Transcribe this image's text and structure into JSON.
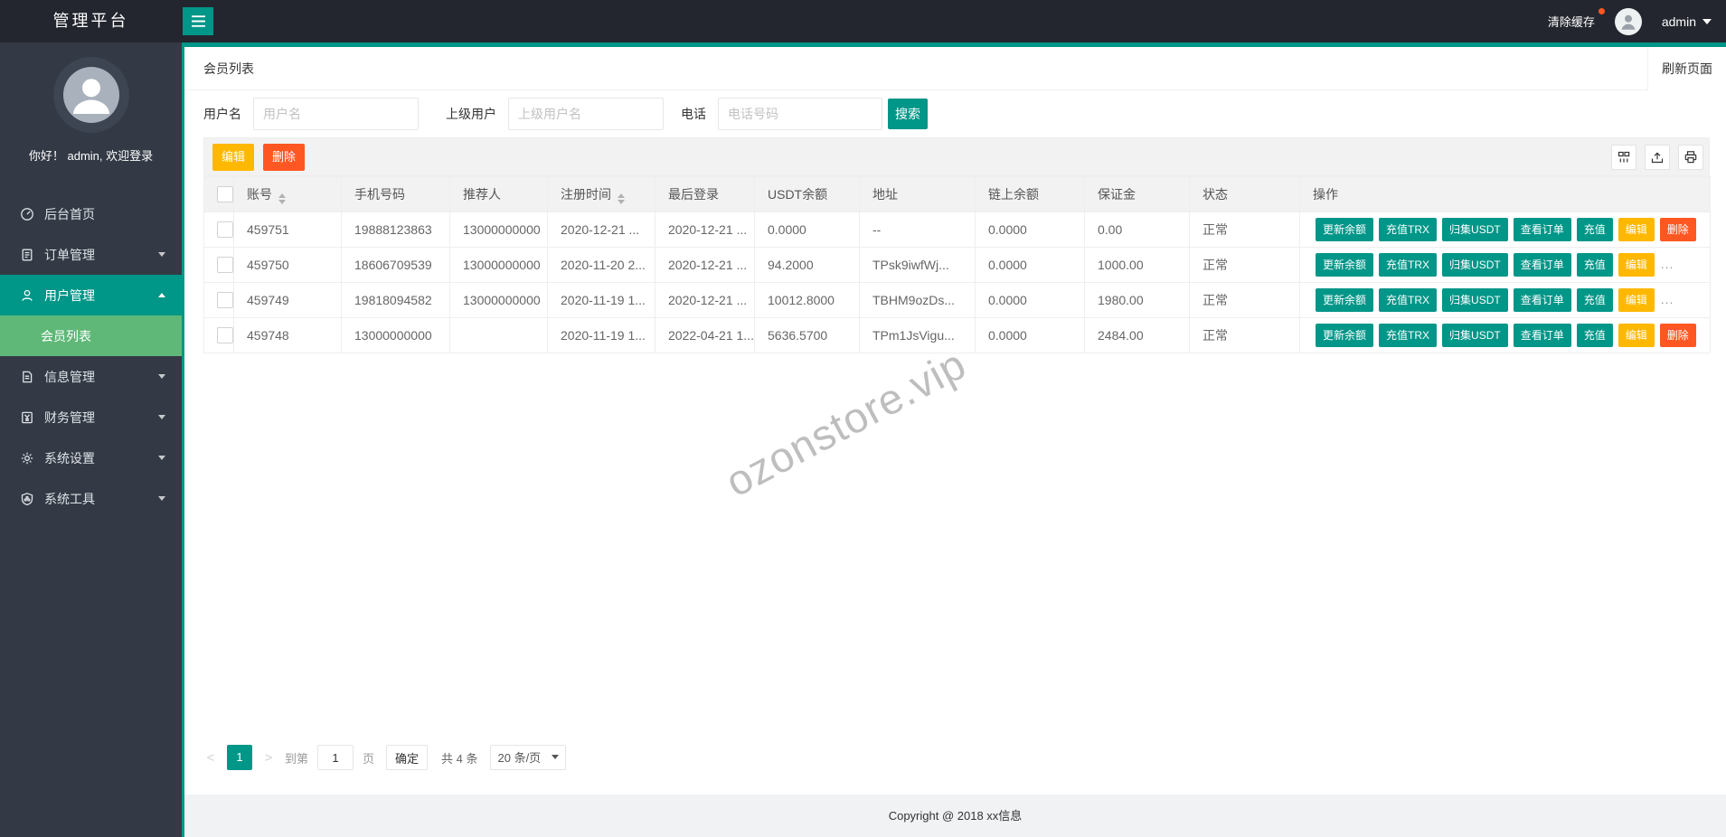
{
  "app": {
    "accent": "#009688",
    "submenu_green": "#5FB878",
    "warn": "#FFB800",
    "danger": "#FF5722"
  },
  "header": {
    "brand": "管理平台",
    "clear_cache": "清除缓存",
    "username": "admin"
  },
  "sidebar": {
    "greeting": "你好！ admin, 欢迎登录",
    "items": [
      {
        "label": "后台首页",
        "icon": "dashboard-icon"
      },
      {
        "label": "订单管理",
        "icon": "orders-icon"
      },
      {
        "label": "用户管理",
        "icon": "users-icon"
      },
      {
        "label": "会员列表",
        "icon": null
      },
      {
        "label": "信息管理",
        "icon": "info-icon"
      },
      {
        "label": "财务管理",
        "icon": "finance-icon"
      },
      {
        "label": "系统设置",
        "icon": "settings-icon"
      },
      {
        "label": "系统工具",
        "icon": "tools-icon"
      }
    ]
  },
  "page": {
    "title": "会员列表",
    "refresh": "刷新页面",
    "watermark": "ozonstore.vip",
    "footer": "Copyright @ 2018 xx信息"
  },
  "search": {
    "fields": [
      {
        "label": "用户名",
        "placeholder": "用户名"
      },
      {
        "label": "上级用户",
        "placeholder": "上级用户名"
      },
      {
        "label": "电话",
        "placeholder": "电话号码"
      }
    ],
    "submit": "搜索"
  },
  "toolbar": {
    "edit": "编辑",
    "delete": "删除",
    "view_icons": [
      "columns-icon",
      "export-icon",
      "print-icon"
    ]
  },
  "table": {
    "columns": [
      "账号",
      "手机号码",
      "推荐人",
      "注册时间",
      "最后登录",
      "USDT余额",
      "地址",
      "链上余额",
      "保证金",
      "状态",
      "操作"
    ],
    "actions": [
      "更新余额",
      "充值TRX",
      "归集USDT",
      "查看订单",
      "充值",
      "编辑",
      "删除"
    ],
    "more_label": "...",
    "rows": [
      {
        "account": "459751",
        "phone": "19888123863",
        "referrer": "13000000000",
        "reg_time": "2020-12-21 ...",
        "last_login": "2020-12-21 ...",
        "usdt": "0.0000",
        "address": "--",
        "chain": "0.0000",
        "deposit": "0.00",
        "status": "正常"
      },
      {
        "account": "459750",
        "phone": "18606709539",
        "referrer": "13000000000",
        "reg_time": "2020-11-20 2...",
        "last_login": "2020-12-21 ...",
        "usdt": "94.2000",
        "address": "TPsk9iwfWj...",
        "chain": "0.0000",
        "deposit": "1000.00",
        "status": "正常"
      },
      {
        "account": "459749",
        "phone": "19818094582",
        "referrer": "13000000000",
        "reg_time": "2020-11-19 1...",
        "last_login": "2020-12-21 ...",
        "usdt": "10012.8000",
        "address": "TBHM9ozDs...",
        "chain": "0.0000",
        "deposit": "1980.00",
        "status": "正常"
      },
      {
        "account": "459748",
        "phone": "13000000000",
        "referrer": "",
        "reg_time": "2020-11-19 1...",
        "last_login": "2022-04-21 1...",
        "usdt": "5636.5700",
        "address": "TPm1JsVigu...",
        "chain": "0.0000",
        "deposit": "2484.00",
        "status": "正常"
      }
    ]
  },
  "pagination": {
    "prev": "<",
    "current": "1",
    "next": ">",
    "goto_prefix": "到第",
    "goto_value": "1",
    "goto_suffix": "页",
    "confirm": "确定",
    "total": "共 4 条",
    "page_size": "20 条/页"
  }
}
